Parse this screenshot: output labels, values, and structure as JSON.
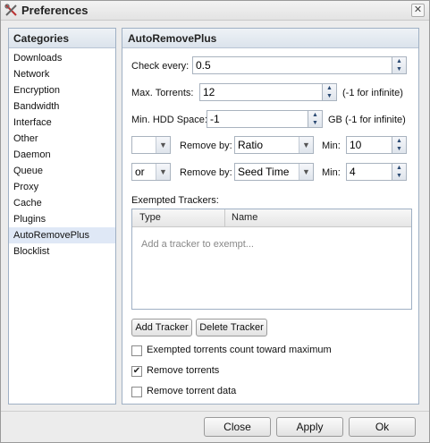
{
  "window": {
    "title": "Preferences",
    "close_label": "✕"
  },
  "sidebar": {
    "header": "Categories",
    "items": [
      "Downloads",
      "Network",
      "Encryption",
      "Bandwidth",
      "Interface",
      "Other",
      "Daemon",
      "Queue",
      "Proxy",
      "Cache",
      "Plugins",
      "AutoRemovePlus",
      "Blocklist"
    ],
    "selected": "AutoRemovePlus"
  },
  "panel": {
    "title": "AutoRemovePlus",
    "check_every": {
      "label": "Check every:",
      "value": "0.5"
    },
    "max_torrents": {
      "label": "Max. Torrents:",
      "value": "12",
      "hint": "(-1 for infinite)"
    },
    "min_hdd": {
      "label": "Min. HDD Space:",
      "value": "-1",
      "hint": "GB (-1 for infinite)"
    },
    "rule1": {
      "logic": "",
      "remove_by_label": "Remove by:",
      "remove_by": "Ratio",
      "min_label": "Min:",
      "min_value": "10"
    },
    "rule2": {
      "logic": "or",
      "remove_by_label": "Remove by:",
      "remove_by": "Seed Time",
      "min_label": "Min:",
      "min_value": "4"
    },
    "exempted": {
      "label": "Exempted Trackers:",
      "columns": [
        "Type",
        "Name"
      ],
      "empty_text": "Add a tracker to exempt..."
    },
    "add_tracker": "Add Tracker",
    "delete_tracker": "Delete Tracker",
    "options": [
      {
        "label": "Exempted torrents count toward maximum",
        "checked": false
      },
      {
        "label": "Remove torrents",
        "checked": true
      },
      {
        "label": "Remove torrent data",
        "checked": false
      }
    ]
  },
  "footer": {
    "close": "Close",
    "apply": "Apply",
    "ok": "Ok"
  }
}
